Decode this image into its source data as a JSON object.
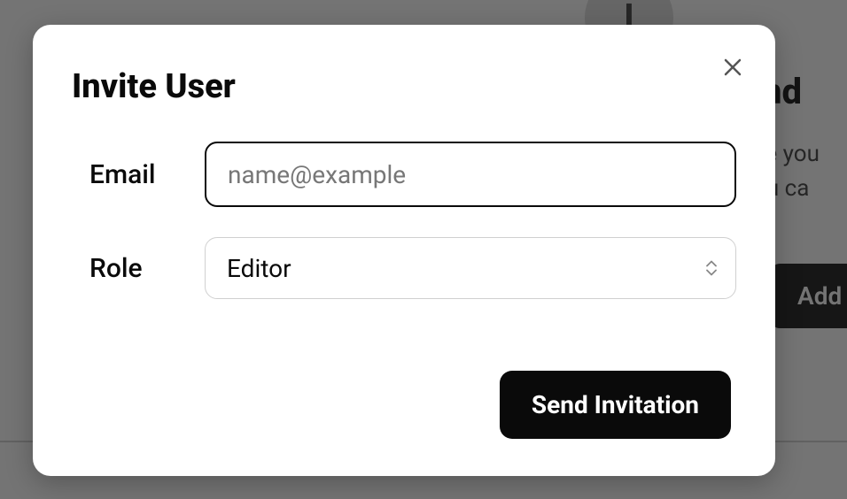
{
  "background": {
    "avatar_initial": "I",
    "heading_partial": "nd",
    "line1_partial": "se you",
    "line2_partial": "ou ca",
    "button_partial": "Add So"
  },
  "modal": {
    "title": "Invite User",
    "fields": {
      "email": {
        "label": "Email",
        "placeholder": "name@example",
        "value": ""
      },
      "role": {
        "label": "Role",
        "selected": "Editor"
      }
    },
    "submit_label": "Send Invitation"
  }
}
